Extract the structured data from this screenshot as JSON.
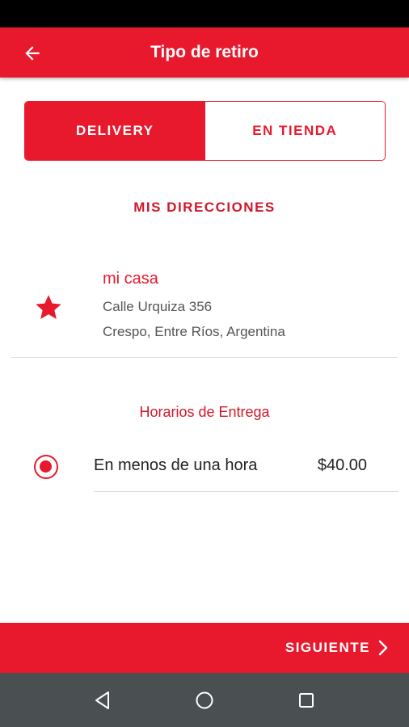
{
  "header": {
    "title": "Tipo de retiro"
  },
  "segmented": {
    "delivery_label": "DELIVERY",
    "store_label": "EN TIENDA"
  },
  "addresses": {
    "heading": "MIS DIRECCIONES",
    "items": [
      {
        "name": "mi casa",
        "street": "Calle Urquiza 356",
        "city": "Crespo, Entre Ríos, Argentina",
        "icon": "star-icon"
      }
    ]
  },
  "delivery_hours": {
    "heading": "Horarios de Entrega",
    "options": [
      {
        "label": "En menos de una hora",
        "price": "$40.00",
        "selected": true
      }
    ]
  },
  "footer": {
    "next_label": "SIGUIENTE"
  },
  "colors": {
    "accent": "#e8192c",
    "status_bar": "#000000",
    "nav_bar": "#4a4f52"
  }
}
